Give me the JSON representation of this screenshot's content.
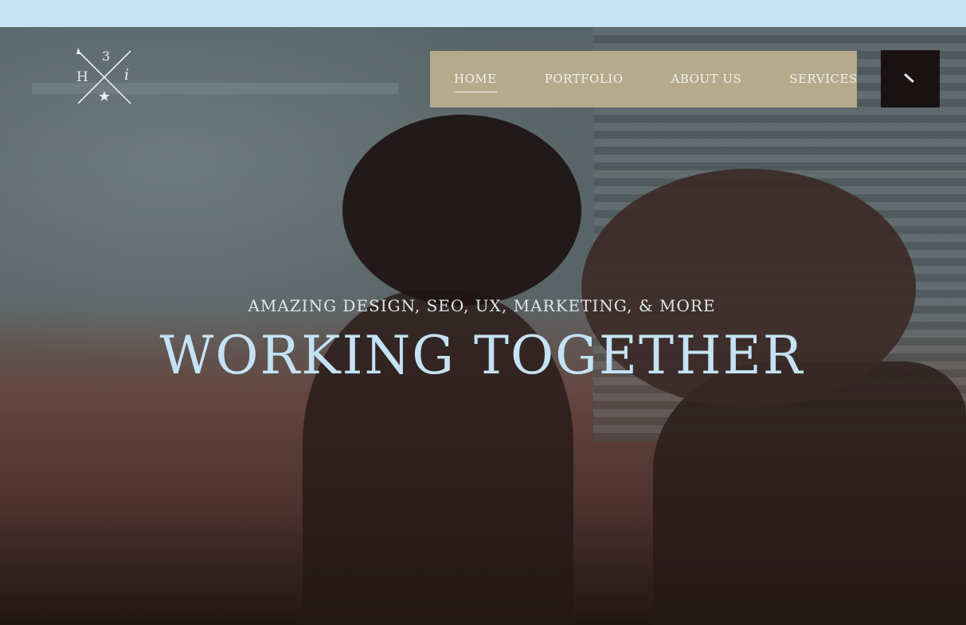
{
  "page": {
    "top_bar_color": "#c7e3f5",
    "accent_headline_color": "#c4e2f4"
  },
  "logo": {
    "letters": [
      "H",
      "3",
      "i"
    ],
    "icon": "crossed-arrows-star-logo"
  },
  "nav": {
    "background": "#b5aa8c",
    "items": [
      {
        "label": "HOME",
        "active": true
      },
      {
        "label": "PORTFOLIO",
        "active": false
      },
      {
        "label": "ABOUT US",
        "active": false
      },
      {
        "label": "SERVICES",
        "active": false
      }
    ]
  },
  "search": {
    "icon": "search-icon",
    "background": "#1a1212"
  },
  "hero": {
    "tagline": "AMAZING DESIGN, SEO, UX, MARKETING, & MORE",
    "headline": "WORKING TOGETHER"
  }
}
